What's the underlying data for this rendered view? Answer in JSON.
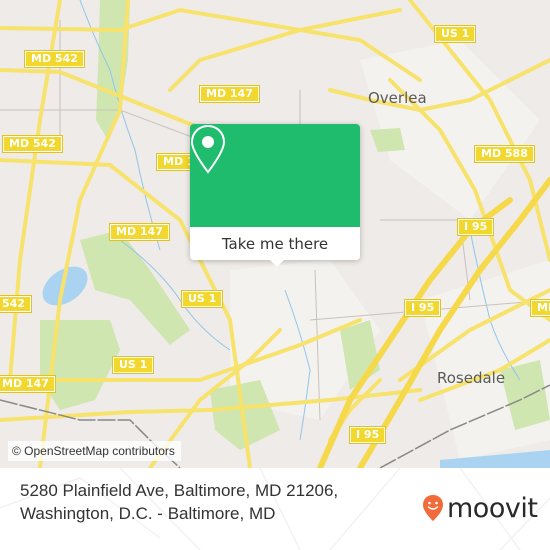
{
  "map": {
    "road_labels": [
      {
        "id": "md542-a",
        "text": "MD 542"
      },
      {
        "id": "md542-b",
        "text": "MD 542"
      },
      {
        "id": "md542-c",
        "text": "542"
      },
      {
        "id": "md147-a",
        "text": "MD 147"
      },
      {
        "id": "md147-b",
        "text": "MD 1"
      },
      {
        "id": "md147-c",
        "text": "MD 147"
      },
      {
        "id": "md147-d",
        "text": "MD 147"
      },
      {
        "id": "us1-a",
        "text": "US 1"
      },
      {
        "id": "us1-b",
        "text": "US 1"
      },
      {
        "id": "us1-c",
        "text": "US 1"
      },
      {
        "id": "md588",
        "text": "MD 588"
      },
      {
        "id": "i95-a",
        "text": "I 95"
      },
      {
        "id": "i95-b",
        "text": "I 95"
      },
      {
        "id": "i95-c",
        "text": "I 95"
      },
      {
        "id": "md-right",
        "text": "MD"
      }
    ],
    "places": [
      {
        "id": "overlea",
        "text": "Overlea"
      },
      {
        "id": "rosedale",
        "text": "Rosedale"
      }
    ],
    "attribution": "© OpenStreetMap contributors",
    "colors": {
      "land": "#efebe8",
      "road": "#f7e26b",
      "park": "#cfe6b0",
      "water": "#a9d3f0"
    }
  },
  "popup": {
    "icon": "location-pin-icon",
    "action_label": "Take me there",
    "accent_color": "#1ebc6c"
  },
  "footer": {
    "address_line1": "5280 Plainfield Ave, Baltimore, MD 21206,",
    "address_line2": "Washington, D.C. - Baltimore, MD",
    "brand_name": "moovit",
    "brand_color": "#f26b3a"
  }
}
